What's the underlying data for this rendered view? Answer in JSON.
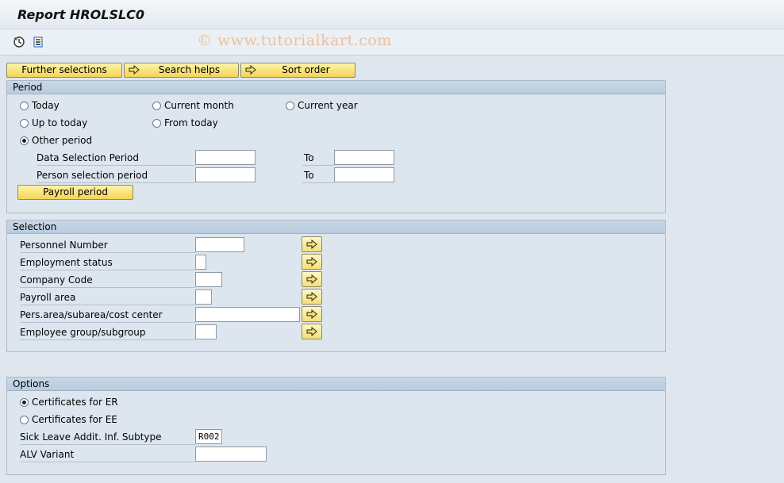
{
  "window": {
    "title": "Report HROLSLC0"
  },
  "watermark": "© www.tutorialkart.com",
  "toolbar": {
    "icons": [
      "execute-icon",
      "get-variant-icon"
    ]
  },
  "tabs": [
    {
      "label": "Further selections"
    },
    {
      "label": "Search helps"
    },
    {
      "label": "Sort order"
    }
  ],
  "period": {
    "title": "Period",
    "options": {
      "today": "Today",
      "current_month": "Current month",
      "current_year": "Current year",
      "up_to_today": "Up to today",
      "from_today": "From today",
      "other_period": "Other period"
    },
    "selected": "other_period",
    "data_selection_label": "Data Selection Period",
    "person_selection_label": "Person selection period",
    "to_label": "To",
    "payroll_button": "Payroll period"
  },
  "selection": {
    "title": "Selection",
    "fields": [
      {
        "label": "Personnel Number",
        "value": ""
      },
      {
        "label": "Employment status",
        "value": ""
      },
      {
        "label": "Company Code",
        "value": ""
      },
      {
        "label": "Payroll area",
        "value": ""
      },
      {
        "label": "Pers.area/subarea/cost center",
        "value": ""
      },
      {
        "label": "Employee group/subgroup",
        "value": ""
      }
    ]
  },
  "options": {
    "title": "Options",
    "radio_er": "Certificates for ER",
    "radio_ee": "Certificates for EE",
    "selected": "er",
    "subtype_label": "Sick Leave Addit. Inf. Subtype",
    "subtype_value": "R002",
    "alv_label": "ALV Variant",
    "alv_value": ""
  },
  "colors": {
    "button": "#f4d457",
    "group_header": "#c4d4e6",
    "background": "#dfe6ee"
  }
}
